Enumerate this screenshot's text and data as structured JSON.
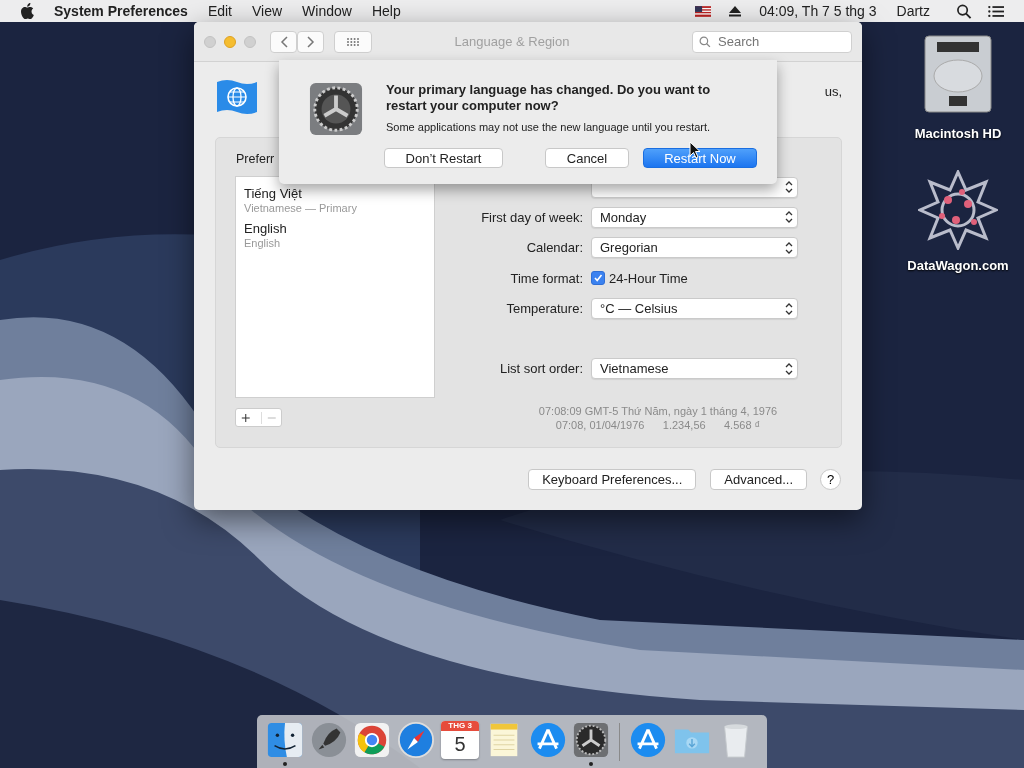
{
  "menu_bar": {
    "app_name": "System Preferences",
    "menus": [
      "Edit",
      "View",
      "Window",
      "Help"
    ],
    "clock": "04:09, Th 7 5 thg 3",
    "user": "Dartz"
  },
  "desktop_icons": [
    {
      "label": "Macintosh HD"
    },
    {
      "label": "DataWagon.com"
    }
  ],
  "window": {
    "title": "Language & Region",
    "search": {
      "placeholder": "Search"
    },
    "header_text": "us,",
    "preferred_languages": {
      "label": "Preferr",
      "languages": [
        {
          "name": "Tiếng Việt",
          "detail": "Vietnamese — Primary"
        },
        {
          "name": "English",
          "detail": "English"
        }
      ]
    },
    "settings": [
      {
        "kind": "popup"
      },
      {
        "kind": "popup",
        "label": "First day of week:",
        "value": "Monday"
      },
      {
        "kind": "popup",
        "label": "Calendar:",
        "value": "Gregorian"
      },
      {
        "kind": "checkbox",
        "label": "Time format:",
        "value": "24-Hour Time",
        "checked": true
      },
      {
        "kind": "popup",
        "label": "Temperature:",
        "value": "°C — Celsius"
      }
    ],
    "sort_order": {
      "label": "List sort order:",
      "value": "Vietnamese"
    },
    "sample_lines": [
      "07:08:09 GMT-5 Thứ Năm, ngày 1 tháng 4, 1976",
      "07:08, 01/04/1976      1.234,56      4.568 ₫"
    ],
    "buttons": [
      "Keyboard Preferences...",
      "Advanced...",
      "?"
    ]
  },
  "sheet": {
    "title": "Your primary language has changed. Do you want to restart your computer now?",
    "message": "Some applications may not use the new language until you restart.",
    "buttons": [
      {
        "label": "Don’t Restart",
        "default": false
      },
      {
        "label": "Cancel",
        "default": false
      },
      {
        "label": "Restart Now",
        "default": true
      }
    ]
  },
  "dock": {
    "items": [
      {
        "running": true
      },
      {
        "running": false
      },
      {
        "running": false
      },
      {
        "running": false
      },
      {
        "running": false,
        "month": "THG 3",
        "day": "5"
      },
      {
        "running": false
      },
      {
        "running": false
      },
      {
        "running": true
      },
      {
        "running": false
      },
      {
        "running": false
      },
      {
        "running": false
      }
    ]
  }
}
